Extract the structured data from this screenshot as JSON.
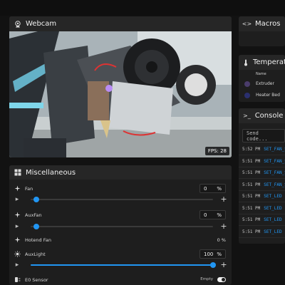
{
  "webcam": {
    "title": "Webcam",
    "fps_label": "FPS: 28"
  },
  "misc": {
    "title": "Miscellaneous",
    "fan": {
      "label": "Fan",
      "value": "0",
      "unit": "%",
      "level": 0
    },
    "auxfan": {
      "label": "AuxFan",
      "value": "0",
      "unit": "%",
      "level": 0
    },
    "hotend_fan": {
      "label": "Hotend Fan",
      "value": "0 %"
    },
    "auxlight": {
      "label": "AuxLight",
      "value": "100",
      "unit": "%",
      "level": 1
    },
    "e0_sensor": {
      "label": "E0 Sensor",
      "state_text": "Empty"
    }
  },
  "macros": {
    "title": "Macros"
  },
  "temperatures": {
    "title": "Temperatures",
    "col_name": "Name",
    "rows": [
      {
        "name": "Extruder",
        "color": "#4a3c6b"
      },
      {
        "name": "Heater Bed",
        "color": "#2a2f6e"
      }
    ]
  },
  "console": {
    "title": "Console",
    "placeholder": "Send code...",
    "lines": [
      {
        "time": "5:52 PM",
        "cmd": "SET_FAN_S"
      },
      {
        "time": "5:51 PM",
        "cmd": "SET_FAN_S"
      },
      {
        "time": "5:51 PM",
        "cmd": "SET_FAN_S"
      },
      {
        "time": "5:51 PM",
        "cmd": "SET_FAN_S"
      },
      {
        "time": "5:51 PM",
        "cmd": "SET_LED"
      },
      {
        "time": "5:51 PM",
        "cmd": "SET_LED"
      },
      {
        "time": "5:51 PM",
        "cmd": "SET_LED"
      },
      {
        "time": "5:51 PM",
        "cmd": "SET_LED"
      }
    ]
  },
  "colors": {
    "accent": "#2196f3",
    "card": "#1e1e1e",
    "header": "#262626"
  }
}
